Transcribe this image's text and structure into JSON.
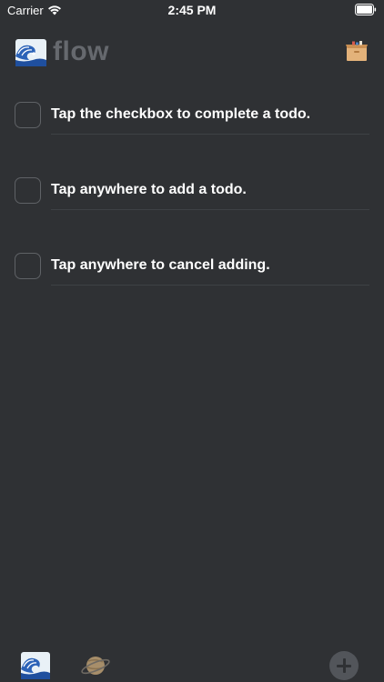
{
  "status_bar": {
    "carrier": "Carrier",
    "time": "2:45 PM"
  },
  "header": {
    "title": "flow",
    "logo_icon": "wave-emoji-icon",
    "archive_icon": "archive-box-icon"
  },
  "todos": [
    {
      "text": "Tap the checkbox to complete a todo.",
      "checked": false
    },
    {
      "text": "Tap anywhere to add a todo.",
      "checked": false
    },
    {
      "text": "Tap anywhere to cancel adding.",
      "checked": false
    }
  ],
  "tab_bar": {
    "tabs": [
      {
        "icon": "wave-emoji-icon",
        "active": true
      },
      {
        "icon": "planet-emoji-icon",
        "active": false
      }
    ],
    "add_icon": "plus-icon"
  },
  "colors": {
    "background": "#2f3134",
    "title": "#66696e",
    "checkbox_border": "#5f6266",
    "add_button": "#52555a"
  }
}
